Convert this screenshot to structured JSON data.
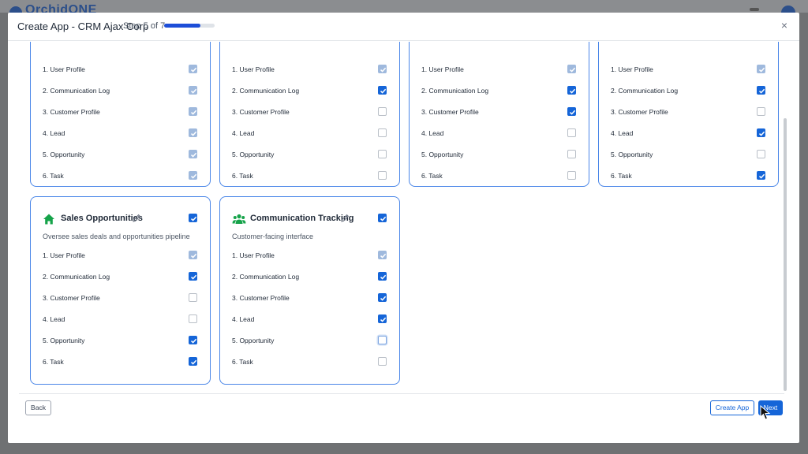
{
  "background": {
    "logo_text": "OrchidONE"
  },
  "modal": {
    "title": "Create App  - CRM Ajax Corp",
    "step_text": "Step 5 of 7",
    "progress": {
      "current": 5,
      "total": 7
    },
    "close_label": "×"
  },
  "permissions": [
    "1. User Profile",
    "2. Communication Log",
    "3. Customer Profile",
    "4. Lead",
    "5. Opportunity",
    "6. Task"
  ],
  "top_cards": [
    {
      "states": [
        "locked",
        "locked",
        "locked",
        "locked",
        "locked",
        "locked"
      ]
    },
    {
      "states": [
        "locked",
        "checked",
        "unchecked",
        "unchecked",
        "unchecked",
        "unchecked"
      ]
    },
    {
      "states": [
        "locked",
        "checked",
        "checked",
        "unchecked",
        "unchecked",
        "unchecked"
      ]
    },
    {
      "states": [
        "locked",
        "checked",
        "unchecked",
        "checked",
        "unchecked",
        "checked"
      ]
    }
  ],
  "bottom_cards": [
    {
      "title": "Sales Opportunities",
      "description": "Oversee sales deals and opportunities pipeline",
      "icon": "home-icon",
      "icon_color": "#16a34a",
      "selected": true,
      "states": [
        "locked",
        "checked",
        "unchecked",
        "unchecked",
        "checked",
        "checked"
      ]
    },
    {
      "title": "Communication Tracking",
      "description": "Customer-facing interface",
      "icon": "users-icon",
      "icon_color": "#16a34a",
      "selected": true,
      "states": [
        "locked",
        "checked",
        "checked",
        "checked",
        "focus",
        "unchecked"
      ]
    }
  ],
  "footer": {
    "back_label": "Back",
    "create_label": "Create App",
    "next_label": "Next"
  },
  "colors": {
    "accent": "#1565d8",
    "card_border": "#4a86e8",
    "locked": "#9fb9dd"
  }
}
